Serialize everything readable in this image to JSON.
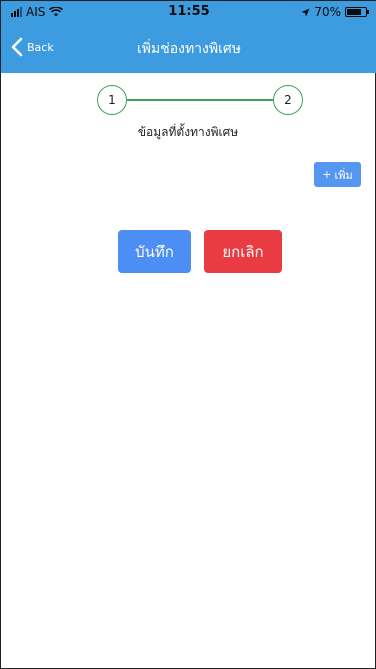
{
  "status_bar": {
    "carrier": "AIS",
    "time": "11:55",
    "battery": "70%"
  },
  "nav": {
    "back_label": "Back",
    "title": "เพิ่มช่องทางพิเศษ"
  },
  "stepper": {
    "steps": [
      "1",
      "2"
    ],
    "label": "ข้อมูลที่ตั้งทางพิเศษ"
  },
  "actions": {
    "add_label": "เพิ่ม",
    "add_symbol": "+",
    "save_label": "บันทึก",
    "cancel_label": "ยกเลิก"
  },
  "colors": {
    "header": "#3d9be0",
    "step_accent": "#3fa35a",
    "primary": "#4c8ef3",
    "danger": "#ea3a42"
  }
}
